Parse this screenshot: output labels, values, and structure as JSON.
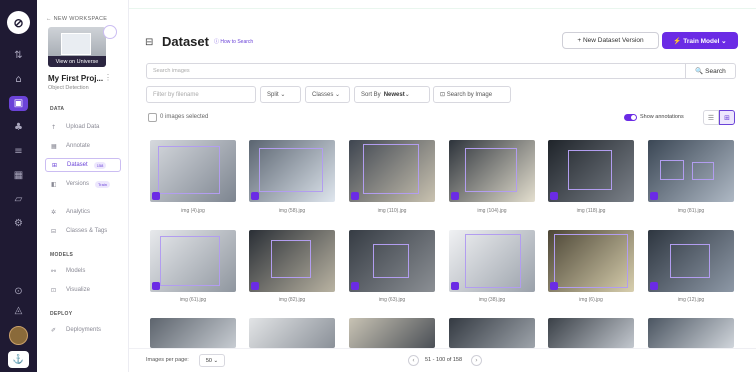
{
  "rail": {
    "logo_glyph": "⊘",
    "icons": [
      {
        "name": "projects-icon",
        "glyph": "⇅"
      },
      {
        "name": "home-icon",
        "glyph": "⌂"
      },
      {
        "name": "dataset-icon",
        "glyph": "▣"
      },
      {
        "name": "models-icon",
        "glyph": "♣"
      },
      {
        "name": "layers-icon",
        "glyph": "≡"
      },
      {
        "name": "apps-icon",
        "glyph": "▦"
      },
      {
        "name": "deploy-icon",
        "glyph": "▱"
      },
      {
        "name": "settings-icon",
        "glyph": "⚙"
      },
      {
        "name": "help-icon",
        "glyph": "⊙"
      },
      {
        "name": "notifications-icon",
        "glyph": "◬"
      }
    ],
    "bottom_glyph": "⚓"
  },
  "sidebar": {
    "workspace_link": "← NEW WORKSPACE",
    "view_universe": "View on Universe",
    "project_name": "My First Proj...",
    "project_kebab": "⋮",
    "project_type": "Object Detection",
    "sections": {
      "data": "DATA",
      "models": "MODELS",
      "deploy": "DEPLOY"
    },
    "items": [
      {
        "label": "Upload Data",
        "glyph": "↑"
      },
      {
        "label": "Annotate",
        "glyph": "▦"
      },
      {
        "label": "Dataset",
        "glyph": "⊞",
        "pill": "158"
      },
      {
        "label": "Versions",
        "glyph": "◧",
        "pill": "Train"
      },
      {
        "label": "Analytics",
        "glyph": "✲"
      },
      {
        "label": "Classes & Tags",
        "glyph": "⊟"
      },
      {
        "label": "Models",
        "glyph": "⚯"
      },
      {
        "label": "Visualize",
        "glyph": "⊡"
      },
      {
        "label": "Deployments",
        "glyph": "✐"
      }
    ]
  },
  "header": {
    "title_glyph": "⊟",
    "title": "Dataset",
    "howto": "ⓘ How to Search",
    "new_version": "+  New Dataset Version",
    "train_model": "⚡ Train Model  ⌄"
  },
  "search": {
    "placeholder": "Search images",
    "button": "🔍 Search"
  },
  "filters": {
    "filename_placeholder": "Filter by filename",
    "split": "Split  ⌄",
    "classes": "Classes  ⌄",
    "sort_label": "Sort By ",
    "sort_value": "Newest",
    "sort_caret": "  ⌄",
    "by_image": "⊡  Search by Image"
  },
  "selection": {
    "text": "0 images selected"
  },
  "annotations": {
    "label": "Show annotations",
    "enabled": true
  },
  "view": {
    "list_glyph": "☰",
    "grid_glyph": "⊞"
  },
  "images": [
    {
      "caption": "img (4).jpg"
    },
    {
      "caption": "img (58).jpg"
    },
    {
      "caption": "img (110).jpg"
    },
    {
      "caption": "img (104).jpg"
    },
    {
      "caption": "img (118).jpg"
    },
    {
      "caption": "img (81).jpg"
    },
    {
      "caption": "img (61).jpg"
    },
    {
      "caption": "img (82).jpg"
    },
    {
      "caption": "img (63).jpg"
    },
    {
      "caption": "img (38).jpg"
    },
    {
      "caption": "img (6).jpg"
    },
    {
      "caption": "img (12).jpg"
    }
  ],
  "footer": {
    "images_per_page": "Images per page:",
    "per_page_value": "50 ⌄",
    "prev": "‹",
    "next": "›",
    "page_text": "51 - 100 of 158"
  },
  "colors": {
    "accent": "#6b2be5",
    "rail_bg": "#1f1a33"
  }
}
